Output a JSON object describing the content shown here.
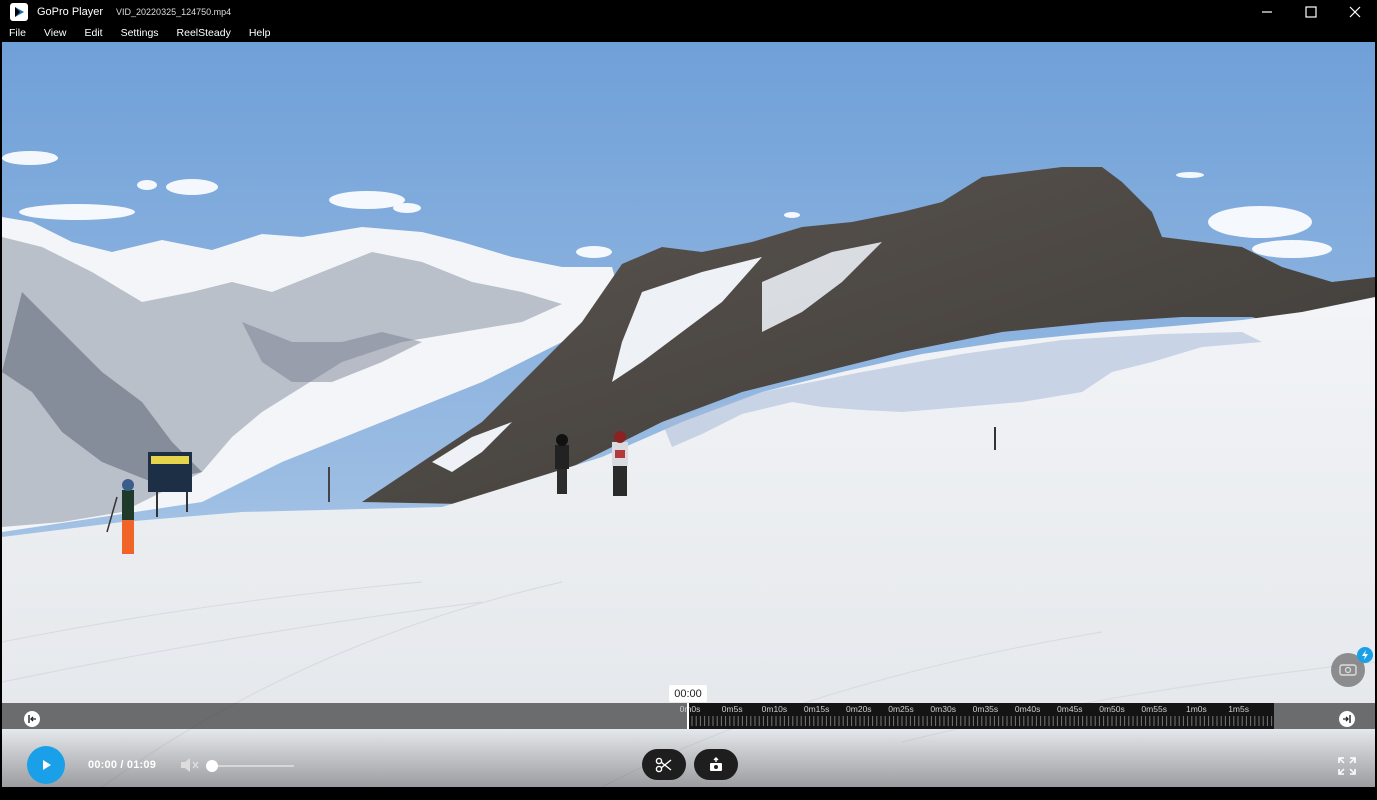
{
  "window": {
    "app_name": "GoPro Player",
    "file_name": "VID_20220325_124750.mp4",
    "controls": [
      "minimize-icon",
      "maximize-icon",
      "close-icon"
    ]
  },
  "menu": {
    "items": [
      "File",
      "View",
      "Edit",
      "Settings",
      "ReelSteady",
      "Help"
    ]
  },
  "timeline": {
    "current_time": "00:00",
    "labels": [
      "0m0s",
      "0m5s",
      "0m10s",
      "0m15s",
      "0m20s",
      "0m25s",
      "0m30s",
      "0m35s",
      "0m40s",
      "0m45s",
      "0m50s",
      "0m55s",
      "1m0s",
      "1m5s"
    ],
    "duration_seconds": 69,
    "position_seconds": 0
  },
  "player": {
    "time_display": "00:00 / 01:09",
    "volume": 0,
    "muted": true,
    "accent_color": "#1aa0e8"
  },
  "icons": {
    "play": "play-icon",
    "mute": "speaker-muted-icon",
    "trim": "scissors-icon",
    "frame_grab": "camera-export-icon",
    "fullscreen": "fullscreen-icon",
    "jump_start": "jump-to-start-icon",
    "jump_end": "jump-to-end-icon",
    "reelsteady": "reelsteady-icon"
  }
}
